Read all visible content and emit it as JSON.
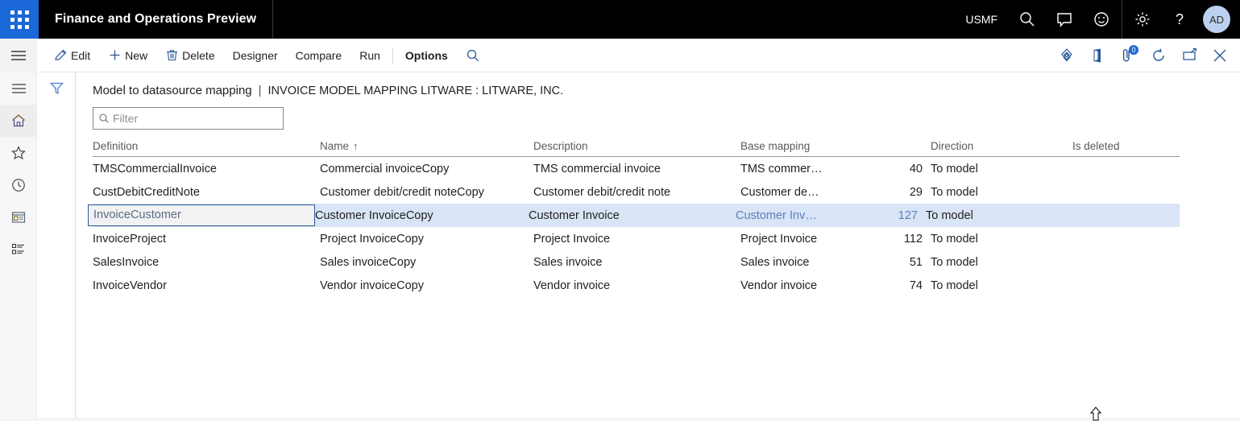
{
  "topbar": {
    "app_title": "Finance and Operations Preview",
    "company_code": "USMF",
    "avatar_initials": "AD",
    "icons": [
      "search-icon",
      "message-icon",
      "feedback-smiley-icon",
      "settings-gear-icon",
      "help-question-icon"
    ]
  },
  "actionpane": {
    "buttons": [
      {
        "label": "Edit",
        "icon": "pencil-icon"
      },
      {
        "label": "New",
        "icon": "plus-icon"
      },
      {
        "label": "Delete",
        "icon": "trash-icon"
      },
      {
        "label": "Designer",
        "icon": ""
      },
      {
        "label": "Compare",
        "icon": ""
      },
      {
        "label": "Run",
        "icon": ""
      }
    ],
    "active_tab": "Options",
    "search_icon": "search-icon",
    "right_icons": [
      {
        "name": "powerbi-diamond-icon"
      },
      {
        "name": "office-app-icon"
      },
      {
        "name": "attachments-icon",
        "badge": "0"
      },
      {
        "name": "refresh-icon"
      },
      {
        "name": "popout-icon"
      },
      {
        "name": "close-icon"
      }
    ]
  },
  "rail": {
    "items": [
      {
        "name": "hamburger-icon",
        "active": false
      },
      {
        "name": "home-icon",
        "active": true
      },
      {
        "name": "favorites-star-icon",
        "active": false
      },
      {
        "name": "recent-clock-icon",
        "active": false
      },
      {
        "name": "workspaces-icon",
        "active": false
      },
      {
        "name": "modules-list-icon",
        "active": false
      }
    ]
  },
  "page": {
    "title": "Model to datasource mapping",
    "separator": "|",
    "caption": "INVOICE MODEL MAPPING LITWARE : LITWARE, INC.",
    "filter_icon": "filter-funnel-icon",
    "filter_placeholder": "Filter",
    "filter_value": ""
  },
  "grid": {
    "columns": [
      {
        "key": "definition",
        "label": "Definition",
        "sort": ""
      },
      {
        "key": "name",
        "label": "Name",
        "sort": "↑"
      },
      {
        "key": "description",
        "label": "Description",
        "sort": ""
      },
      {
        "key": "base_mapping",
        "label": "Base mapping",
        "sort": ""
      },
      {
        "key": "direction",
        "label": "Direction",
        "sort": ""
      },
      {
        "key": "is_deleted",
        "label": "Is deleted",
        "sort": ""
      }
    ],
    "rows": [
      {
        "definition": "TMSCommercialInvoice",
        "name": "Commercial invoiceCopy",
        "description": "TMS commercial invoice",
        "base_mapping": "TMS commer…",
        "base_mapping_number": "40",
        "direction": "To model",
        "is_deleted": "",
        "selected": false
      },
      {
        "definition": "CustDebitCreditNote",
        "name": "Customer debit/credit noteCopy",
        "description": "Customer debit/credit note",
        "base_mapping": "Customer de…",
        "base_mapping_number": "29",
        "direction": "To model",
        "is_deleted": "",
        "selected": false
      },
      {
        "definition": "InvoiceCustomer",
        "name": "Customer InvoiceCopy",
        "description": "Customer Invoice",
        "base_mapping": "Customer Inv…",
        "base_mapping_number": "127",
        "direction": "To model",
        "is_deleted": "",
        "selected": true
      },
      {
        "definition": "InvoiceProject",
        "name": "Project InvoiceCopy",
        "description": "Project Invoice",
        "base_mapping": "Project Invoice",
        "base_mapping_number": "112",
        "direction": "To model",
        "is_deleted": "",
        "selected": false
      },
      {
        "definition": "SalesInvoice",
        "name": "Sales invoiceCopy",
        "description": "Sales invoice",
        "base_mapping": "Sales invoice",
        "base_mapping_number": "51",
        "direction": "To model",
        "is_deleted": "",
        "selected": false
      },
      {
        "definition": "InvoiceVendor",
        "name": "Vendor invoiceCopy",
        "description": "Vendor invoice",
        "base_mapping": "Vendor invoice",
        "base_mapping_number": "74",
        "direction": "To model",
        "is_deleted": "",
        "selected": false
      }
    ]
  },
  "colors": {
    "brand_blue": "#1b68d8",
    "accent_blue": "#2b579a",
    "selection_blue": "#d9e4f7",
    "topbar_black": "#000000",
    "avatar_bg": "#bcd0ef"
  }
}
